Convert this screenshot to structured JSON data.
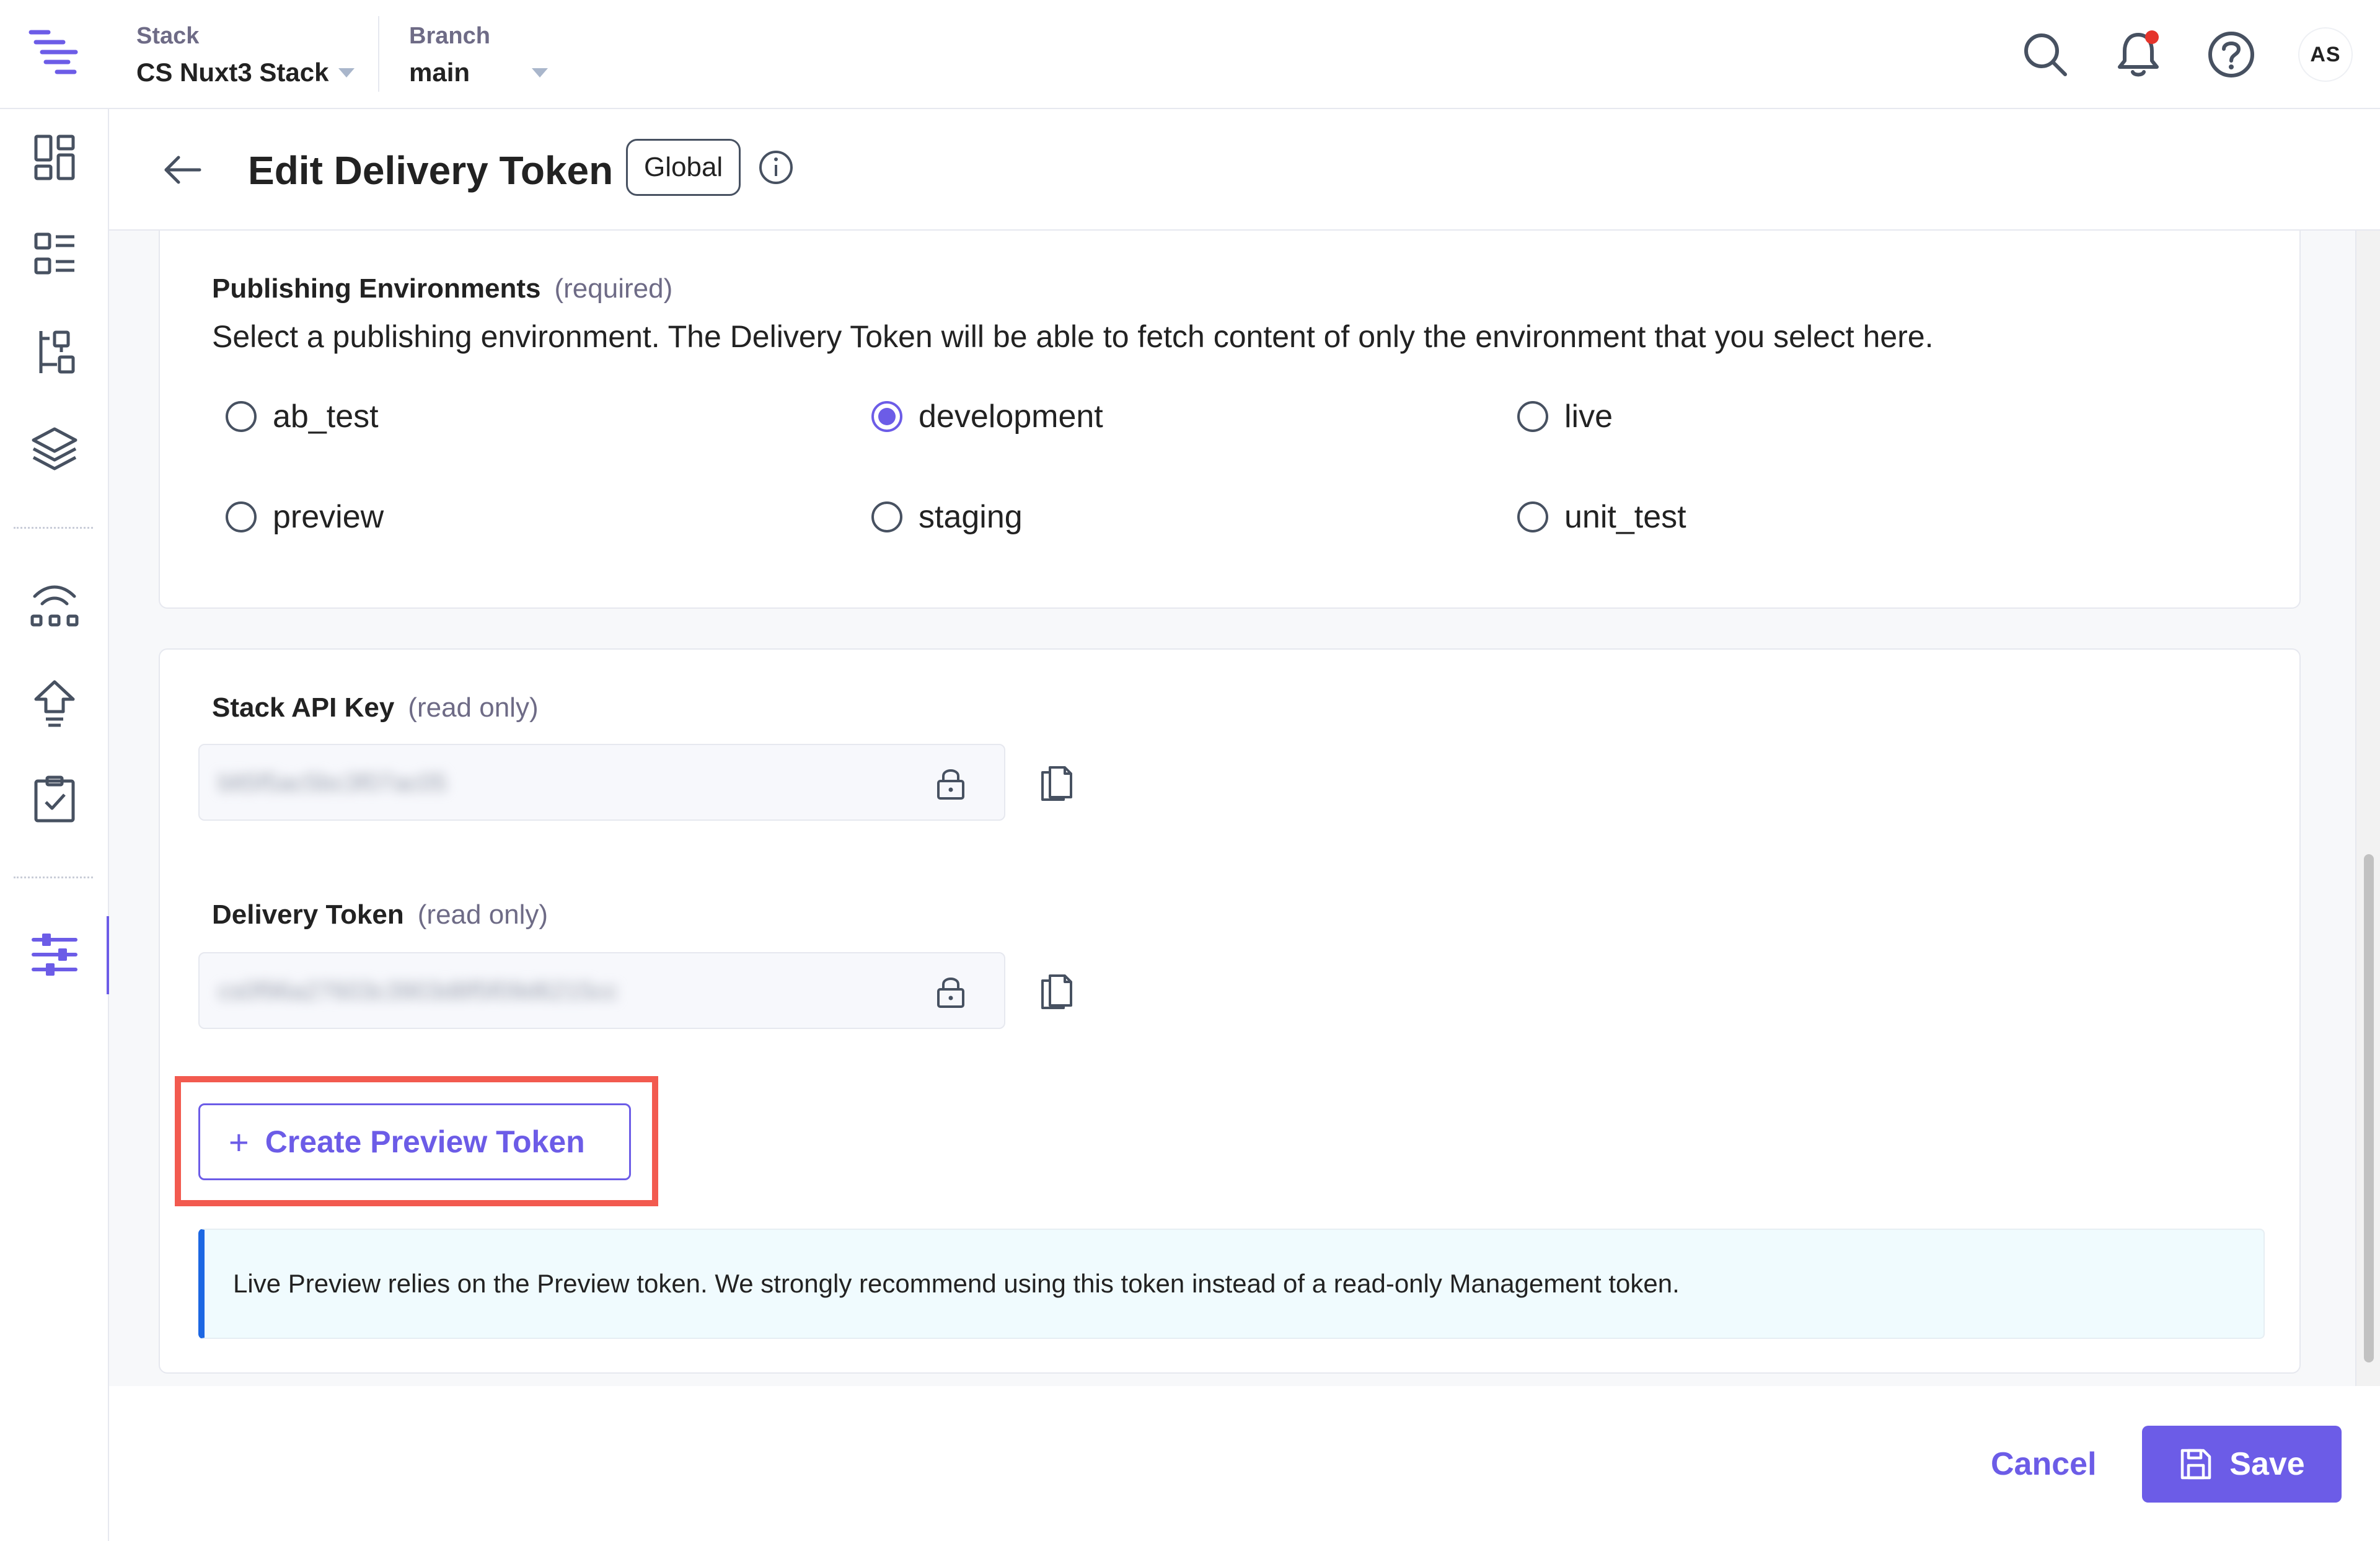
{
  "header": {
    "stack_label": "Stack",
    "stack_value": "CS Nuxt3 Stack",
    "branch_label": "Branch",
    "branch_value": "main",
    "avatar_initials": "AS",
    "notification_dot_color": "#e5342b",
    "icons": [
      "search-icon",
      "bell-icon",
      "help-icon"
    ]
  },
  "sidebar": {
    "items": [
      {
        "name": "dashboard-icon"
      },
      {
        "name": "entries-icon"
      },
      {
        "name": "content-models-icon"
      },
      {
        "name": "assets-icon"
      },
      {
        "name": "webhooks-icon"
      },
      {
        "name": "deploy-icon"
      },
      {
        "name": "tasks-icon"
      },
      {
        "name": "settings-icon",
        "active": true
      }
    ],
    "accent_color": "#6c5ce7"
  },
  "page": {
    "title": "Edit Delivery Token",
    "badge": "Global"
  },
  "publishing": {
    "label": "Publishing Environments",
    "hint": "(required)",
    "description": "Select a publishing environment. The Delivery Token will be able to fetch content of only the environment that you select here.",
    "environments": [
      {
        "label": "ab_test",
        "checked": false
      },
      {
        "label": "development",
        "checked": true
      },
      {
        "label": "live",
        "checked": false
      },
      {
        "label": "preview",
        "checked": false
      },
      {
        "label": "staging",
        "checked": false
      },
      {
        "label": "unit_test",
        "checked": false
      }
    ]
  },
  "api_key": {
    "label": "Stack API Key",
    "hint": "(read only)",
    "value": "blt5f5ac5bc3f07ac05"
  },
  "delivery_token": {
    "label": "Delivery Token",
    "hint": "(read only)",
    "value": "cs0f96a27603c3903d8f5f09d6215cc"
  },
  "create_preview": {
    "label": "Create Preview Token",
    "plus": "+",
    "highlight_color": "#f25a4f"
  },
  "notice": {
    "text": "Live Preview relies on the Preview token. We strongly recommend using this token instead of a read-only Management token.",
    "accent_color": "#1c67e3"
  },
  "footer": {
    "cancel_label": "Cancel",
    "save_label": "Save"
  }
}
